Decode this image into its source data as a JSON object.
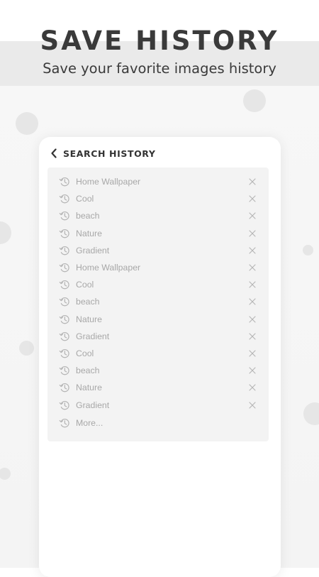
{
  "header": {
    "headline": "SAVE HISTORY",
    "subtitle": "Save your favorite images history"
  },
  "screen": {
    "title": "SEARCH HISTORY",
    "items": [
      {
        "label": "Home Wallpaper"
      },
      {
        "label": "Cool"
      },
      {
        "label": "beach"
      },
      {
        "label": "Nature"
      },
      {
        "label": "Gradient"
      },
      {
        "label": "Home Wallpaper"
      },
      {
        "label": "Cool"
      },
      {
        "label": "beach"
      },
      {
        "label": "Nature"
      },
      {
        "label": "Gradient"
      },
      {
        "label": "Cool"
      },
      {
        "label": "beach"
      },
      {
        "label": "Nature"
      },
      {
        "label": "Gradient"
      }
    ],
    "more_label": "More..."
  },
  "colors": {
    "headline": "#3a3a3a",
    "band": "#eaeaea",
    "panel": "#f3f3f3",
    "item_text": "#a8a8a8",
    "icon": "#b4b4b4"
  },
  "icons": {
    "back": "chevron-left-icon",
    "history": "history-icon",
    "remove": "close-icon"
  }
}
